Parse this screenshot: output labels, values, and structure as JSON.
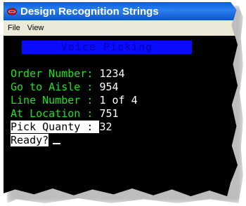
{
  "window": {
    "title": "Design Recognition Strings",
    "icon": "app-window-icon"
  },
  "menu": {
    "items": [
      "File",
      "View"
    ]
  },
  "terminal": {
    "banner": "Voice Picking",
    "rows": [
      {
        "label": "Order Number: ",
        "value": "1234"
      },
      {
        "label": "Go to Aisle : ",
        "value": "954"
      },
      {
        "label": "Line Number : ",
        "value": "1 of 4"
      },
      {
        "label": "At Location : ",
        "value": "751"
      },
      {
        "label": "Pick Quanty : ",
        "value": "32"
      }
    ],
    "prompt": "Ready?",
    "colors": {
      "label": "#19e619",
      "value": "#ffffff",
      "banner_bg": "#0a0aff",
      "banner_text": "#0000a8",
      "highlight_bg": "#ffffff"
    }
  }
}
